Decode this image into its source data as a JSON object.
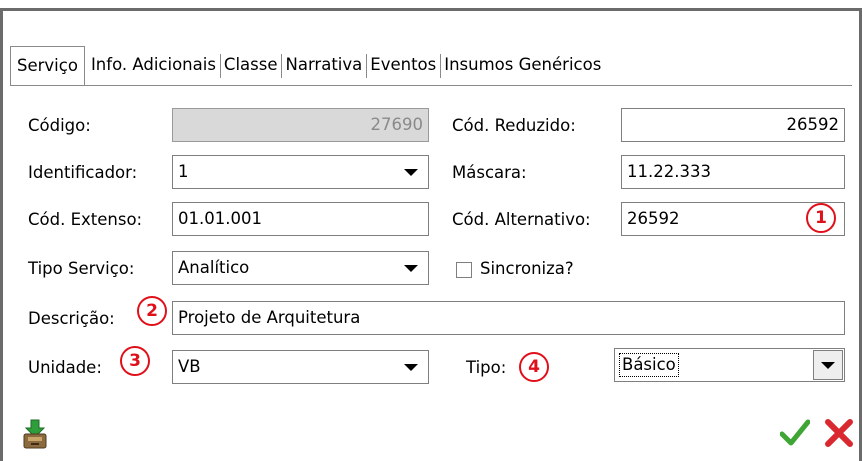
{
  "tabs": [
    {
      "label": "Serviço",
      "active": true
    },
    {
      "label": "Info. Adicionais",
      "active": false
    },
    {
      "label": "Classe",
      "active": false
    },
    {
      "label": "Narrativa",
      "active": false
    },
    {
      "label": "Eventos",
      "active": false
    },
    {
      "label": "Insumos Genéricos",
      "active": false
    }
  ],
  "form": {
    "codigo": {
      "label": "Código:",
      "value": "27690"
    },
    "cod_reduzido": {
      "label": "Cód. Reduzido:",
      "value": "26592"
    },
    "identificador": {
      "label": "Identificador:",
      "value": "1"
    },
    "mascara": {
      "label": "Máscara:",
      "value": "11.22.333"
    },
    "cod_extenso": {
      "label": "Cód. Extenso:",
      "value": "01.01.001"
    },
    "cod_alternativo": {
      "label": "Cód. Alternativo:",
      "value": "26592"
    },
    "tipo_servico": {
      "label": "Tipo Serviço:",
      "value": "Analítico"
    },
    "sincroniza": {
      "label": "Sincroniza?",
      "checked": false
    },
    "descricao": {
      "label": "Descrição:",
      "value": "Projeto de Arquitetura"
    },
    "unidade": {
      "label": "Unidade:",
      "value": "VB"
    },
    "tipo": {
      "label": "Tipo:",
      "value": "Básico"
    }
  },
  "annotations": [
    "1",
    "2",
    "3",
    "4"
  ],
  "footer": {
    "left_icon": "save-to-archive-icon",
    "ok_icon": "green-checkmark-icon",
    "cancel_icon": "red-x-icon"
  },
  "colors": {
    "annotation": "#e0101a",
    "ok": "#3fa535",
    "cancel": "#d9282f",
    "disabled_bg": "#d9d9d9"
  }
}
